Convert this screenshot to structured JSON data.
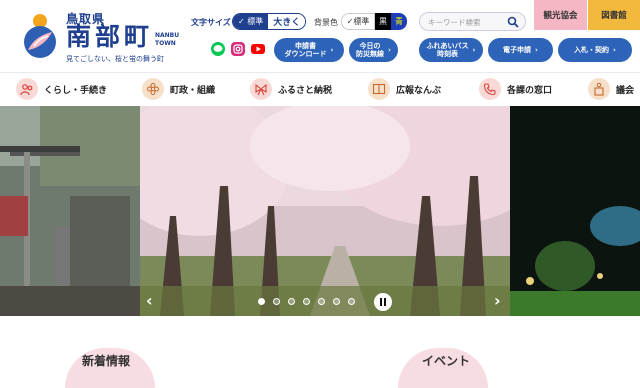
{
  "logo": {
    "prefecture": "鳥取県",
    "town": "南部町",
    "town_en": "NANBU TOWN",
    "slogan": "見てごしない、桜と蛍の舞う町"
  },
  "utility": {
    "font_size_label": "文字サイズ",
    "font_standard": "標準",
    "font_large": "大きく",
    "bg_label": "背景色",
    "bg_standard": "標準",
    "bg_black": "黒",
    "bg_blue": "青",
    "search_placeholder": "キーワード検索"
  },
  "corner_buttons": [
    {
      "label": "観光協会",
      "color": "#f6b7c4"
    },
    {
      "label": "図書館",
      "color": "#f3b93c"
    }
  ],
  "sns": [
    {
      "icon": "line-icon",
      "color": "#06c755"
    },
    {
      "icon": "instagram-icon",
      "color": "#d6307d"
    },
    {
      "icon": "youtube-icon",
      "color": "#ff0000"
    }
  ],
  "quick_links": [
    {
      "label1": "申請書",
      "label2": "ダウンロード"
    },
    {
      "label1": "今日の",
      "label2": "防災無線"
    },
    {
      "label1": "ふれあいバス",
      "label2": "時刻表"
    },
    {
      "label1": "電子申請",
      "label2": ""
    },
    {
      "label1": "入札・契約",
      "label2": ""
    }
  ],
  "gnav": [
    {
      "label": "くらし・手続き",
      "icon": "people-icon"
    },
    {
      "label": "町政・組織",
      "icon": "flower-icon"
    },
    {
      "label": "ふるさと納税",
      "icon": "ribbon-icon"
    },
    {
      "label": "広報なんぶ",
      "icon": "book-icon"
    },
    {
      "label": "各課の窓口",
      "icon": "phone-icon"
    },
    {
      "label": "議会",
      "icon": "podium-icon"
    }
  ],
  "slider": {
    "slide_count": 7,
    "active_slide": 1,
    "prev_label": "‹",
    "next_label": "›"
  },
  "sections": {
    "news": "新着情報",
    "event": "イベント"
  },
  "colors": {
    "brand": "#1f3f8f",
    "pill": "#2d63b8",
    "nav_icon_bg": "#f9d9d6"
  }
}
